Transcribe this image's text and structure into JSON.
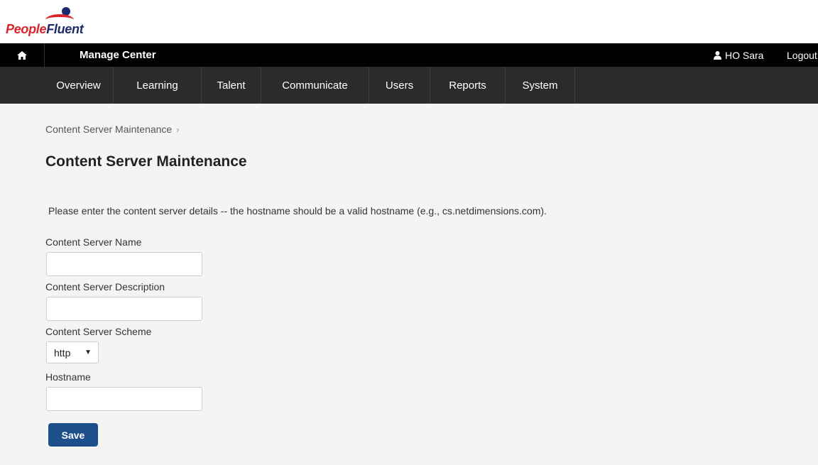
{
  "brand": {
    "logo_part1": "People",
    "logo_part2": "Fluent",
    "colors": {
      "red": "#d8252b",
      "navy": "#1b2a6b"
    }
  },
  "topbar": {
    "home_icon": "home-icon",
    "title": "Manage Center",
    "user_icon": "user-icon",
    "user_name": "HO Sara",
    "logout_label": "Logout"
  },
  "nav": {
    "items": [
      {
        "label": "Overview"
      },
      {
        "label": "Learning"
      },
      {
        "label": "Talent"
      },
      {
        "label": "Communicate"
      },
      {
        "label": "Users"
      },
      {
        "label": "Reports"
      },
      {
        "label": "System"
      }
    ]
  },
  "breadcrumb": {
    "item": "Content Server Maintenance",
    "separator": "›"
  },
  "page": {
    "title": "Content Server Maintenance",
    "instructions": "Please enter the content server details -- the hostname should be a valid hostname (e.g., cs.netdimensions.com)."
  },
  "form": {
    "name_label": "Content Server Name",
    "name_value": "",
    "description_label": "Content Server Description",
    "description_value": "",
    "scheme_label": "Content Server Scheme",
    "scheme_value": "http",
    "hostname_label": "Hostname",
    "hostname_value": "",
    "save_label": "Save"
  },
  "colors": {
    "topbar_bg": "#000000",
    "navbar_bg": "#2b2b2b",
    "content_bg": "#f4f4f4",
    "primary_button": "#1d4f8a"
  }
}
